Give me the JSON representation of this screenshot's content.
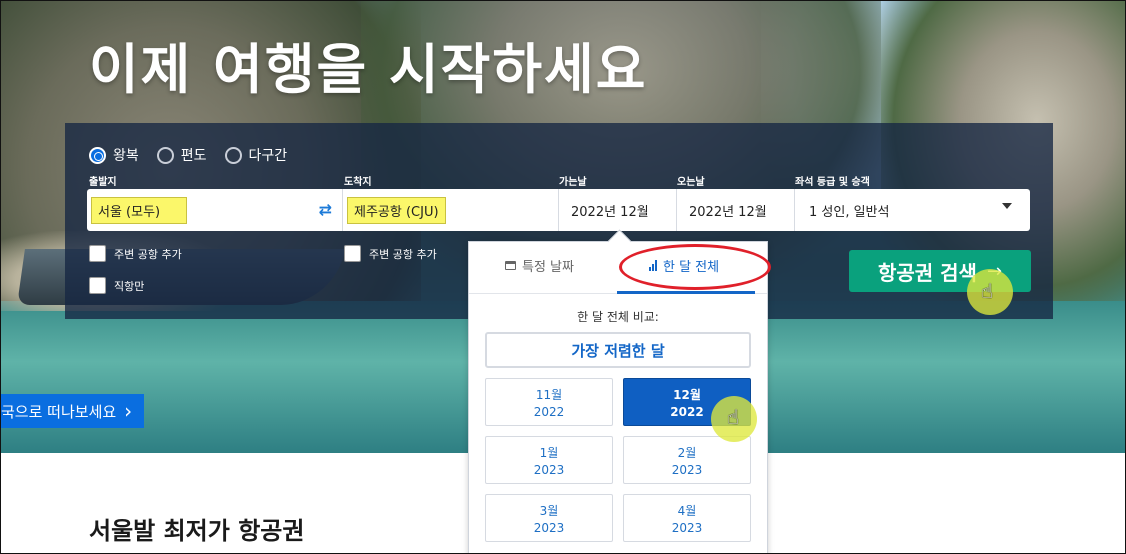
{
  "hero": {
    "title": "이제 여행을 시작하세요"
  },
  "trip_types": [
    {
      "label": "왕복",
      "checked": true
    },
    {
      "label": "편도",
      "checked": false
    },
    {
      "label": "다구간",
      "checked": false
    }
  ],
  "labels": {
    "origin": "출발지",
    "destination": "도착지",
    "depart": "가는날",
    "return": "오는날",
    "cabin": "좌석 등급 및 승객"
  },
  "fields": {
    "origin_value": "서울 (모두)",
    "destination_value": "제주공항 (CJU)",
    "depart_value": "2022년 12월",
    "return_value": "2022년 12월",
    "cabin_value": "1 성인, 일반석"
  },
  "checkboxes": {
    "nearby_origin": "주변 공항 추가",
    "nearby_destination": "주변 공항 추가",
    "direct_only": "직항만"
  },
  "search_button": {
    "label": "항공권 검색",
    "arrow": "→"
  },
  "date_popover": {
    "tab_specific": "특정 날짜",
    "tab_whole_month": "한 달 전체",
    "compare_label": "한 달 전체 비교:",
    "cheapest_month": "가장 저렴한 달",
    "months": [
      {
        "month": "11월",
        "year": "2022",
        "selected": false
      },
      {
        "month": "12월",
        "year": "2022",
        "selected": true
      },
      {
        "month": "1월",
        "year": "2023",
        "selected": false
      },
      {
        "month": "2월",
        "year": "2023",
        "selected": false
      },
      {
        "month": "3월",
        "year": "2023",
        "selected": false
      },
      {
        "month": "4월",
        "year": "2023",
        "selected": false
      }
    ]
  },
  "promo": {
    "label": "국으로 떠나보세요",
    "chevron": "›"
  },
  "section": {
    "title": "서울발 최저가 항공권"
  },
  "icons": {
    "swap": "swap-arrows-icon",
    "dropdown": "caret-down-icon",
    "calendar": "calendar-icon",
    "bar_chart": "bar-chart-icon",
    "pointer": "hand-pointer-icon"
  },
  "colors": {
    "accent_blue": "#0a6ee0",
    "search_green": "#0aa17d",
    "selected_month": "#0f5fc2",
    "highlight_yellow": "#fbf76a",
    "annotation_red": "#e0202a"
  }
}
